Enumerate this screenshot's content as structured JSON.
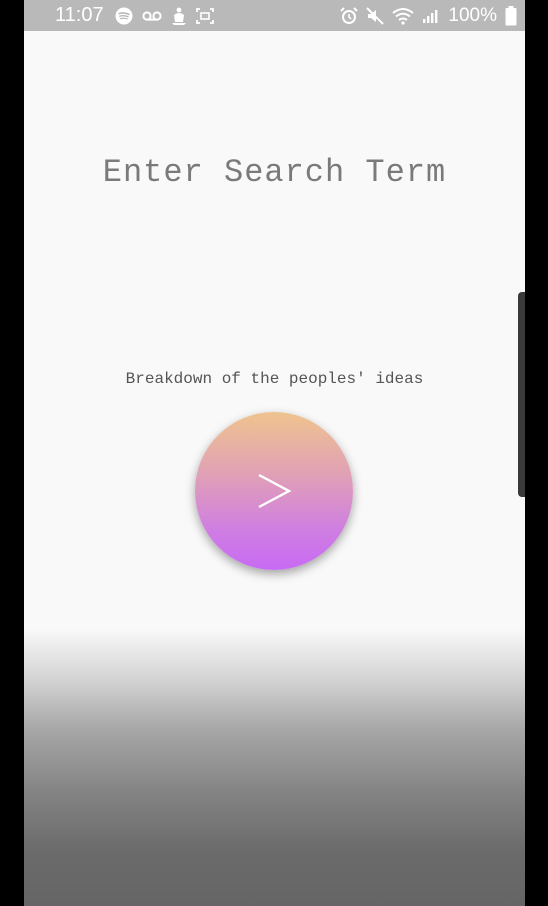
{
  "status_bar": {
    "time": "11:07",
    "battery_percent": "100%",
    "left_icons": [
      "spotify-icon",
      "voicemail-icon",
      "download-app-icon",
      "screenshot-icon"
    ],
    "right_icons": [
      "alarm-icon",
      "mute-icon",
      "wifi-icon",
      "signal-icon",
      "battery-icon"
    ]
  },
  "main": {
    "search_prompt": "Enter Search Term",
    "subtitle": "Breakdown of the peoples' ideas",
    "go_button_icon": "chevron-right-icon"
  },
  "colors": {
    "status_bar_bg": "#b9b9b9",
    "screen_bg": "#f9f9f9",
    "button_gradient_top": "#efc38e",
    "button_gradient_bottom": "#c86af4"
  }
}
